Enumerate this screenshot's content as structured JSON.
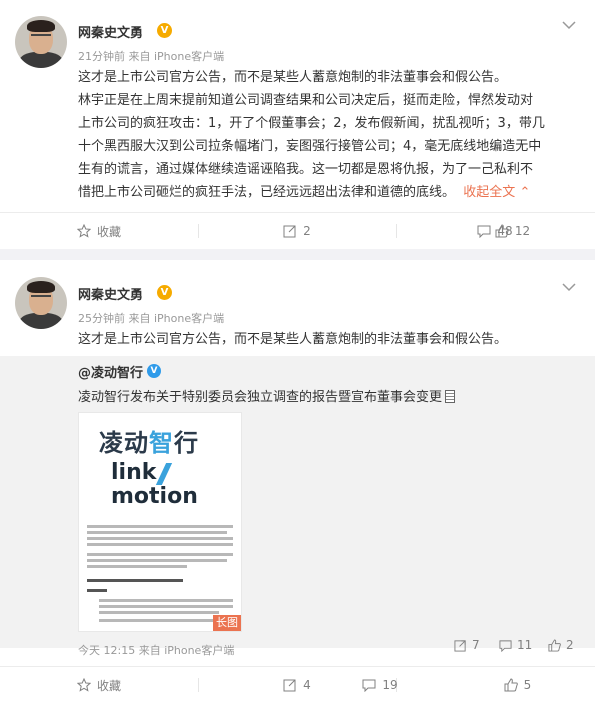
{
  "posts": [
    {
      "username": "网秦史文勇",
      "meta": "21分钟前  来自 iPhone客户端",
      "text_lines": [
        "这才是上市公司官方公告，而不是某些人蓄意炮制的非法董事会和假公告。",
        "林宇正是在上周末提前知道公司调查结果和公司决定后，挺而走险，悍然发动对",
        "上市公司的疯狂攻击：1，开了个假董事会；2，发布假新闻，扰乱视听；3，带几",
        "十个黑西服大汉到公司拉条幅堵门，妄图强行接管公司；4，毫无底线地编造无中",
        "生有的谎言，通过媒体继续造谣诬陷我。这一切都是恩将仇报，为了一己私利不",
        "惜把上市公司砸烂的疯狂手法，已经远远超出法律和道德的底线。"
      ],
      "collapse_label": "收起全文",
      "actions": {
        "favorite": "收藏",
        "repost": "2",
        "comment": "48",
        "like": "12"
      }
    },
    {
      "username": "网秦史文勇",
      "meta": "25分钟前  来自 iPhone客户端",
      "text": "这才是上市公司官方公告，而不是某些人蓄意炮制的非法董事会和假公告。",
      "repost": {
        "user": "@凌动智行",
        "text": "凌动智行发布关于特别委员会独立调查的报告暨宣布董事会变更",
        "image": {
          "logo_cn_a": "凌动",
          "logo_cn_b": "智",
          "logo_cn_c": "行",
          "logo_en_1": "link",
          "logo_en_2": "motion",
          "tag": "长图"
        },
        "meta": "今天 12:15  来自 iPhone客户端",
        "stats": {
          "repost": "7",
          "comment": "11",
          "like": "2"
        }
      },
      "actions": {
        "favorite": "收藏",
        "repost": "4",
        "comment": "19",
        "like": "5"
      }
    }
  ],
  "icons": [
    "chevron-down-icon",
    "star-icon",
    "repost-icon",
    "comment-icon",
    "like-icon",
    "verified-badge-icon",
    "document-icon"
  ],
  "colors": {
    "accent": "#eb7350",
    "verified_orange": "#f6ab00",
    "verified_blue": "#2f9bea",
    "muted": "#808080"
  }
}
